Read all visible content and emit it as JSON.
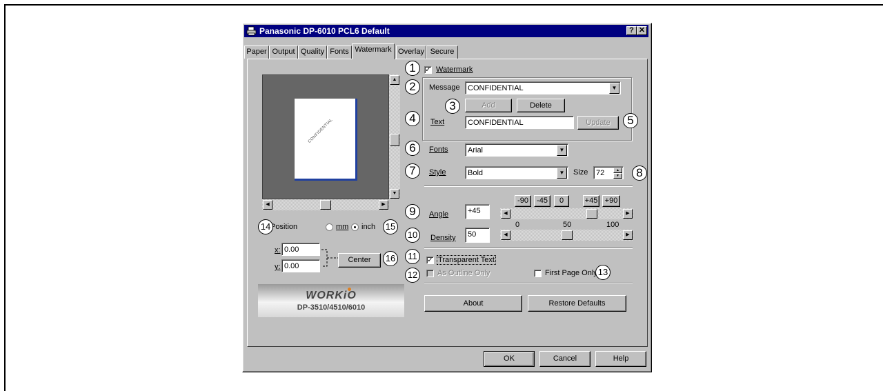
{
  "window": {
    "title": "Panasonic DP-6010 PCL6 Default",
    "help_btn": "?",
    "close_btn": "✕"
  },
  "tabs": [
    {
      "label": "Paper"
    },
    {
      "label": "Output"
    },
    {
      "label": "Quality"
    },
    {
      "label": "Fonts"
    },
    {
      "label": "Watermark"
    },
    {
      "label": "Overlay"
    },
    {
      "label": "Secure"
    }
  ],
  "preview": {
    "watermark_text": "CONFIDENTIAL"
  },
  "position": {
    "label": "Position",
    "unit_mm": "mm",
    "unit_inch": "inch",
    "selected_unit": "inch",
    "x_label": "x:",
    "x_value": "0.00",
    "y_label": "y:",
    "y_value": "0.00",
    "center_button": "Center"
  },
  "logo": {
    "brand": "WORKiO",
    "model": "DP-3510/4510/6010"
  },
  "watermark": {
    "checkbox_label": "Watermark",
    "checked": true
  },
  "message": {
    "label": "Message",
    "value": "CONFIDENTIAL"
  },
  "buttons": {
    "add": "Add",
    "delete": "Delete",
    "update": "Update",
    "about": "About",
    "restore": "Restore Defaults",
    "ok": "OK",
    "cancel": "Cancel",
    "help": "Help"
  },
  "text_field": {
    "label": "Text",
    "value": "CONFIDENTIAL"
  },
  "fonts": {
    "label": "Fonts",
    "value": "Arial"
  },
  "style": {
    "label": "Style",
    "value": "Bold",
    "size_label": "Size",
    "size_value": "72"
  },
  "angle": {
    "label": "Angle",
    "value": "+45",
    "presets": [
      "-90",
      "-45",
      "0",
      "+45",
      "+90"
    ],
    "slider_fraction": 0.75
  },
  "density": {
    "label": "Density",
    "value": "50",
    "scale": [
      "0",
      "50",
      "100"
    ],
    "slider_fraction": 0.5
  },
  "options": {
    "transparent_text": "Transparent Text",
    "transparent_checked": true,
    "as_outline_only": "As Outline Only",
    "outline_checked": false,
    "first_page_only": "First Page Only",
    "first_page_checked": false
  },
  "callouts": [
    "1",
    "2",
    "3",
    "4",
    "5",
    "6",
    "7",
    "8",
    "9",
    "10",
    "11",
    "12",
    "13",
    "14",
    "15",
    "16"
  ]
}
